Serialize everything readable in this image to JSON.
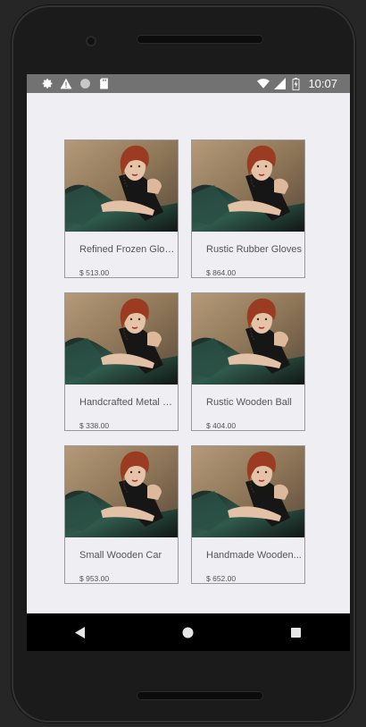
{
  "status_bar": {
    "time": "10:07",
    "left_icons": [
      "settings-icon",
      "warning-icon",
      "circle-icon",
      "sd-card-icon"
    ],
    "right_icons": [
      "wifi-icon",
      "signal-icon",
      "battery-icon"
    ]
  },
  "products": [
    {
      "name": "Refined Frozen Gloves",
      "price": "$ 513.00"
    },
    {
      "name": "Rustic Rubber Gloves",
      "price": "$ 864.00"
    },
    {
      "name": "Handcrafted Metal C...",
      "price": "$ 338.00"
    },
    {
      "name": "Rustic Wooden Ball",
      "price": "$ 404.00"
    },
    {
      "name": "Small Wooden Car",
      "price": "$ 953.00"
    },
    {
      "name": "Handmade Wooden...",
      "price": "$ 652.00"
    }
  ],
  "nav_bar": {
    "buttons": [
      "back-icon",
      "home-icon",
      "recents-icon"
    ]
  },
  "colors": {
    "status_bar": "#727272",
    "screen_background": "#efeef3",
    "card_border": "#9a9a9a",
    "text": "#555555",
    "nav_bar": "#000000"
  }
}
